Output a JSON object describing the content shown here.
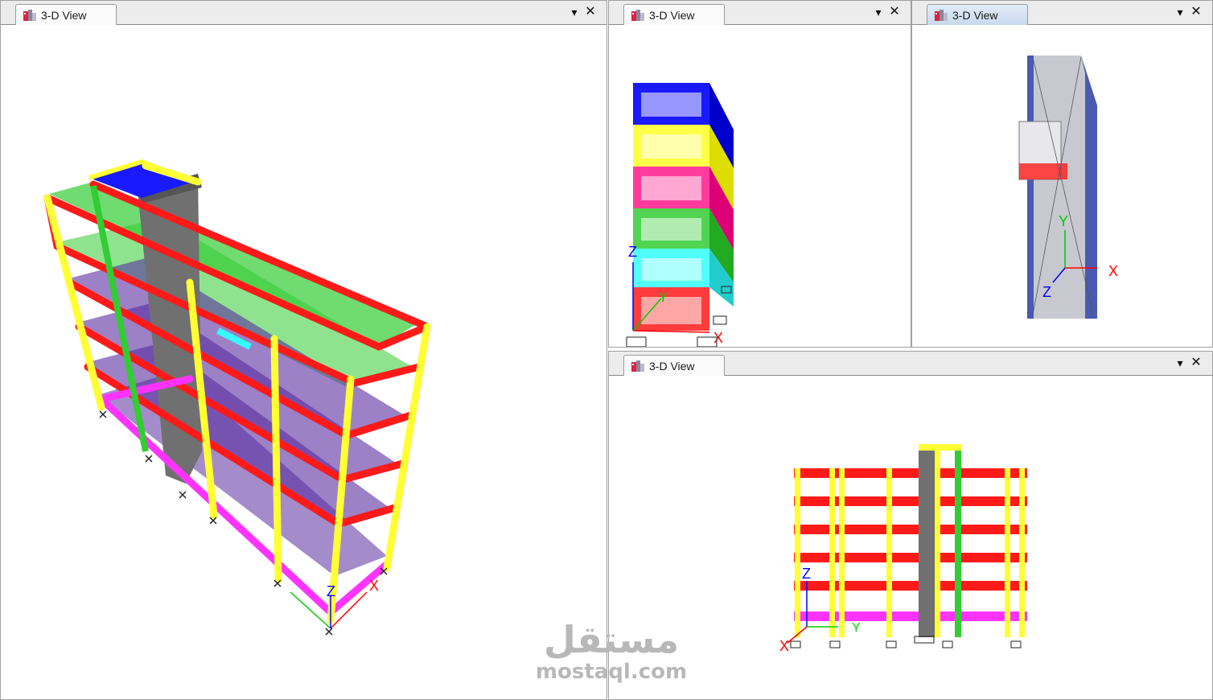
{
  "views": [
    {
      "title": "3-D View",
      "dropdown_icon": "dropdown-arrow-icon",
      "close_icon": "close-icon",
      "active": false
    },
    {
      "title": "3-D View",
      "dropdown_icon": "dropdown-arrow-icon",
      "close_icon": "close-icon",
      "active": false
    },
    {
      "title": "3-D View",
      "dropdown_icon": "dropdown-arrow-icon",
      "close_icon": "close-icon",
      "active": true
    },
    {
      "title": "3-D View",
      "dropdown_icon": "dropdown-arrow-icon",
      "close_icon": "close-icon",
      "active": false
    }
  ],
  "axes": {
    "x": "X",
    "y": "Y",
    "z": "Z"
  },
  "watermark": {
    "arabic": "مستقل",
    "latin": "mostaql.com"
  },
  "colors": {
    "beam_red": "#ff1a1a",
    "column_yellow": "#ffff33",
    "slab_green": "#33cc33",
    "slab_purple": "#5a2da0",
    "ground_magenta": "#ff33ff",
    "core_gray": "#707070",
    "story_blue": "#1a1aff",
    "story_cyan": "#33ffff",
    "axis_x": "#ff0000",
    "axis_y": "#00cc00",
    "axis_z": "#0000ff"
  }
}
